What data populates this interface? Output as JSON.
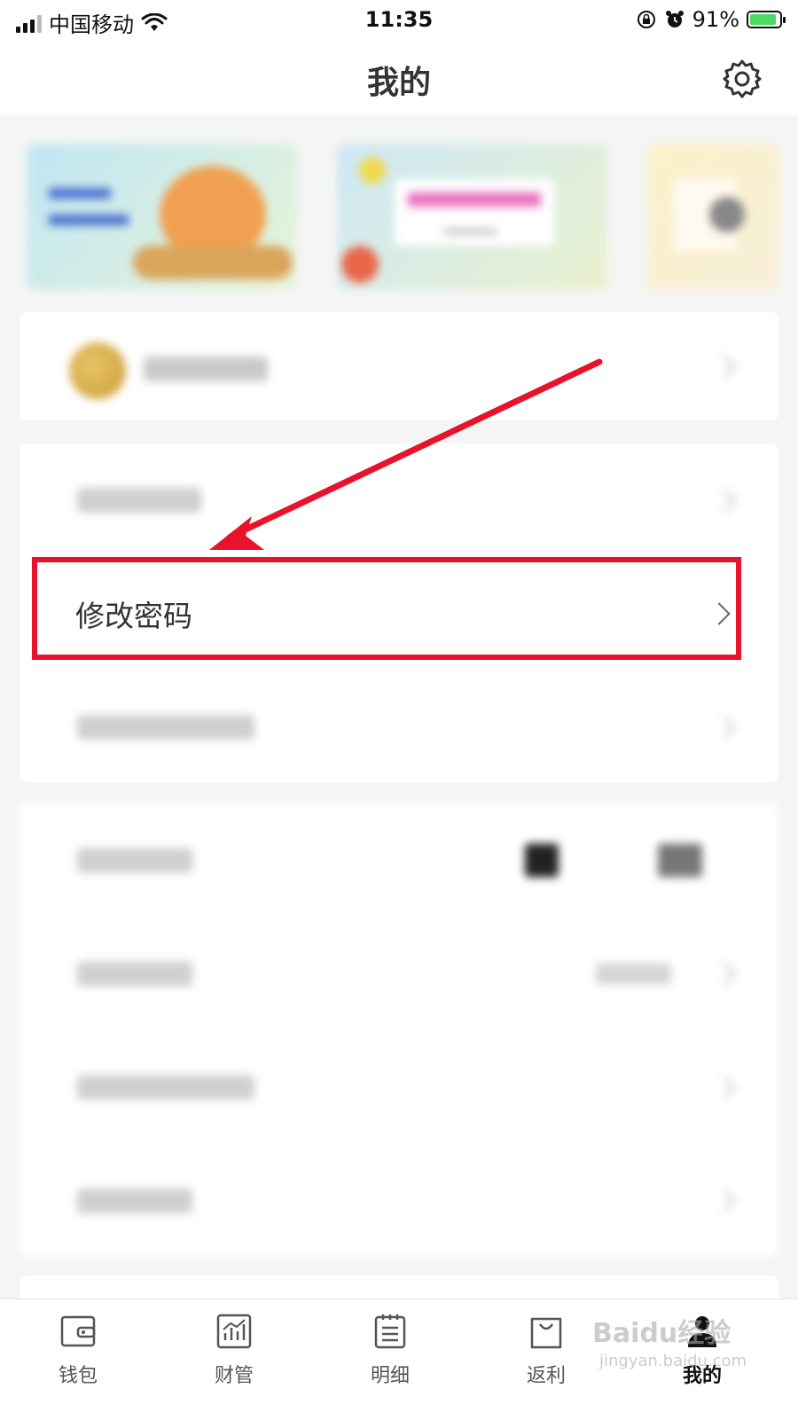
{
  "status_bar": {
    "carrier": "中国移动",
    "time": "11:35",
    "battery_percent": "91%",
    "icons": [
      "signal-icon",
      "wifi-icon",
      "orientation-lock-icon",
      "alarm-icon",
      "battery-icon"
    ]
  },
  "header": {
    "title": "我的",
    "settings_icon": "gear-icon"
  },
  "banners": [
    {
      "name": "promo-banner-1"
    },
    {
      "name": "promo-banner-2"
    },
    {
      "name": "promo-banner-3"
    }
  ],
  "menu": {
    "highlighted_item": {
      "label": "修改密码"
    }
  },
  "tabbar": {
    "items": [
      {
        "label": "钱包",
        "icon": "wallet-icon"
      },
      {
        "label": "财管",
        "icon": "chart-icon"
      },
      {
        "label": "明细",
        "icon": "list-icon"
      },
      {
        "label": "返利",
        "icon": "shopping-bag-icon"
      },
      {
        "label": "我的",
        "icon": "user-icon",
        "active": true
      }
    ]
  },
  "watermark": {
    "brand": "Baidu经验",
    "url": "jingyan.baidu.com"
  },
  "colors": {
    "highlight": "#e8122a",
    "battery": "#4cd964"
  }
}
